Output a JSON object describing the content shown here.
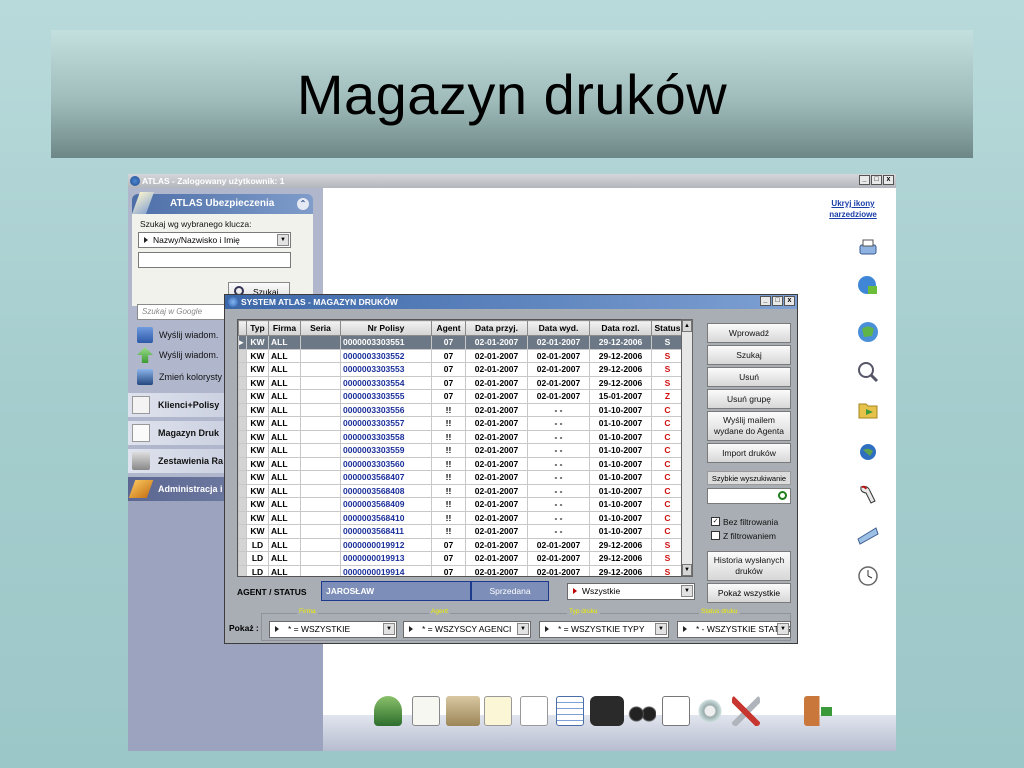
{
  "slide": {
    "title": "Magazyn druków"
  },
  "app": {
    "title": "ATLAS - Zalogowany użytkownik: 1",
    "window_buttons": [
      "_",
      "□",
      "x"
    ],
    "left_panel": {
      "header": "ATLAS Ubezpieczenia",
      "search_key_label": "Szukaj wg wybranego klucza:",
      "search_key_value": "Nazwy/Nazwisko i Imię",
      "search_button": "Szukaj",
      "google_placeholder": "Szukaj w Google",
      "actions": [
        "Wyślij wiadom.",
        "Wyślij wiadom.",
        "Zmień kolorysty"
      ],
      "nav": [
        "Klienci+Polisy",
        "Magazyn Druk",
        "Zestawienia Ra",
        "Administracja i"
      ]
    },
    "right_link": "Ukryj ikony narzedziowe",
    "right_icons": [
      "printer-icon",
      "globe-lock-icon",
      "globe-icon",
      "magnifier-icon",
      "folder-icon",
      "globe-small-icon",
      "pen-icon",
      "ruler-icon",
      "clock-icon"
    ],
    "toolbar_icons": [
      "users-icon",
      "person-card-icon",
      "cabinet-icon",
      "notepad-icon",
      "document-icon",
      "spreadsheet-icon",
      "camera-icon",
      "binoculars-icon",
      "presentation-icon",
      "gear-icon",
      "tools-icon",
      "exit-door-icon"
    ]
  },
  "dialog": {
    "title": "SYSTEM ATLAS - MAGAZYN DRUKÓW",
    "window_buttons": [
      "_",
      "□",
      "x"
    ],
    "columns": [
      "Typ",
      "Firma",
      "Seria",
      "Nr Polisy",
      "Agent",
      "Data przyj.",
      "Data wyd.",
      "Data rozl.",
      "Status"
    ],
    "rows": [
      [
        "KW",
        "ALL",
        "",
        "0000003303551",
        "07",
        "02-01-2007",
        "02-01-2007",
        "29-12-2006",
        "S"
      ],
      [
        "KW",
        "ALL",
        "",
        "0000003303552",
        "07",
        "02-01-2007",
        "02-01-2007",
        "29-12-2006",
        "S"
      ],
      [
        "KW",
        "ALL",
        "",
        "0000003303553",
        "07",
        "02-01-2007",
        "02-01-2007",
        "29-12-2006",
        "S"
      ],
      [
        "KW",
        "ALL",
        "",
        "0000003303554",
        "07",
        "02-01-2007",
        "02-01-2007",
        "29-12-2006",
        "S"
      ],
      [
        "KW",
        "ALL",
        "",
        "0000003303555",
        "07",
        "02-01-2007",
        "02-01-2007",
        "15-01-2007",
        "Z"
      ],
      [
        "KW",
        "ALL",
        "",
        "0000003303556",
        "!!",
        "02-01-2007",
        "- -",
        "01-10-2007",
        "C"
      ],
      [
        "KW",
        "ALL",
        "",
        "0000003303557",
        "!!",
        "02-01-2007",
        "- -",
        "01-10-2007",
        "C"
      ],
      [
        "KW",
        "ALL",
        "",
        "0000003303558",
        "!!",
        "02-01-2007",
        "- -",
        "01-10-2007",
        "C"
      ],
      [
        "KW",
        "ALL",
        "",
        "0000003303559",
        "!!",
        "02-01-2007",
        "- -",
        "01-10-2007",
        "C"
      ],
      [
        "KW",
        "ALL",
        "",
        "0000003303560",
        "!!",
        "02-01-2007",
        "- -",
        "01-10-2007",
        "C"
      ],
      [
        "KW",
        "ALL",
        "",
        "0000003568407",
        "!!",
        "02-01-2007",
        "- -",
        "01-10-2007",
        "C"
      ],
      [
        "KW",
        "ALL",
        "",
        "0000003568408",
        "!!",
        "02-01-2007",
        "- -",
        "01-10-2007",
        "C"
      ],
      [
        "KW",
        "ALL",
        "",
        "0000003568409",
        "!!",
        "02-01-2007",
        "- -",
        "01-10-2007",
        "C"
      ],
      [
        "KW",
        "ALL",
        "",
        "0000003568410",
        "!!",
        "02-01-2007",
        "- -",
        "01-10-2007",
        "C"
      ],
      [
        "KW",
        "ALL",
        "",
        "0000003568411",
        "!!",
        "02-01-2007",
        "- -",
        "01-10-2007",
        "C"
      ],
      [
        "LD",
        "ALL",
        "",
        "0000000019912",
        "07",
        "02-01-2007",
        "02-01-2007",
        "29-12-2006",
        "S"
      ],
      [
        "LD",
        "ALL",
        "",
        "0000000019913",
        "07",
        "02-01-2007",
        "02-01-2007",
        "29-12-2006",
        "S"
      ],
      [
        "LD",
        "ALL",
        "",
        "0000000019914",
        "07",
        "02-01-2007",
        "02-01-2007",
        "29-12-2006",
        "S"
      ]
    ],
    "selected_row": 0,
    "buttons": [
      "Wprowadź",
      "Szukaj",
      "Usuń",
      "Usuń grupę",
      "Wyślij mailem wydane do Agenta",
      "Import druków"
    ],
    "quick_search_label": "Szybkie wyszukiwanie",
    "checkboxes": [
      {
        "label": "Bez filtrowania",
        "checked": true
      },
      {
        "label": "Z filtrowaniem",
        "checked": false
      }
    ],
    "history_button": "Historia wysłanych druków",
    "agent_status_label": "AGENT / STATUS",
    "agent_value": "JAROSŁAW",
    "status_value": "Sprzedana",
    "status_filter": "Wszystkie",
    "show_all_button": "Pokaż wszystkie",
    "pokaz_label": "Pokaż :",
    "filters": [
      {
        "legend": "Firma",
        "value": "* = WSZYSTKIE"
      },
      {
        "legend": "Agent",
        "value": "* = WSZYSCY AGENCI"
      },
      {
        "legend": "Typ druku",
        "value": "* = WSZYSTKIE TYPY"
      },
      {
        "legend": "Status druku",
        "value": "* - WSZYSTKIE STATUSY"
      }
    ]
  },
  "colors": {
    "status_red": "#d01010",
    "selected_row": "#6c7885",
    "link_blue": "#1a3eaa"
  }
}
